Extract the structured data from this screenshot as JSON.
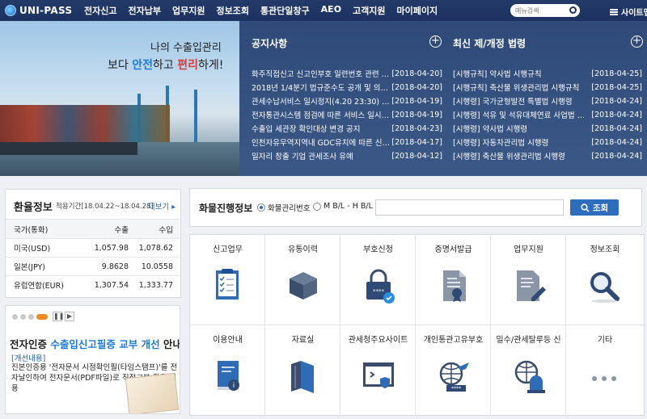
{
  "header": {
    "logo": "UNI-PASS",
    "nav": [
      "전자신고",
      "전자납부",
      "업무지원",
      "정보조회",
      "통관단일창구",
      "AEO",
      "고객지원",
      "마이페이지"
    ],
    "search_placeholder": "메뉴검색",
    "sitemap": "사이트맵"
  },
  "banner": {
    "line1": "나의 수출입관리",
    "line2_pre": "보다 ",
    "line2_a": "안전",
    "line2_mid": "하고 ",
    "line2_b": "편리",
    "line2_post": "하게!"
  },
  "notice": {
    "title": "공지사항",
    "items": [
      {
        "title": "화주직접신고 신고인부호 일련번호 관련 안...",
        "date": "[2018-04-20]"
      },
      {
        "title": "2018년 1/4분기 법규준수도 공개 및 의견제...",
        "date": "[2018-04-20]"
      },
      {
        "title": "관세수납서비스 일시정지(4.20 23:30) 안내",
        "date": "[2018-04-19]"
      },
      {
        "title": "전자통관시스템 점검에 따른 서비스 일시중...",
        "date": "[2018-04-19]"
      },
      {
        "title": "수출입 세관장 확인대상 변경 공지",
        "date": "[2018-04-23]"
      },
      {
        "title": "인천자유무역지역내 GDC유치에 따른 신규 ...",
        "date": "[2018-04-17]"
      },
      {
        "title": "일자리 창출 기업 관세조사 유예",
        "date": "[2018-04-12]"
      }
    ]
  },
  "laws": {
    "title": "최신 제/개정 법령",
    "items": [
      {
        "title": "[시행규칙] 약사법 시행규칙",
        "date": "[2018-04-25]"
      },
      {
        "title": "[시행규칙] 축산물 위생관리법 시행규칙",
        "date": "[2018-04-25]"
      },
      {
        "title": "[시행령] 국가균형발전 특별법 시행령",
        "date": "[2018-04-24]"
      },
      {
        "title": "[시행령] 석유 및 석유대체연료 사업법 시...",
        "date": "[2018-04-24]"
      },
      {
        "title": "[시행령] 약사법 시행령",
        "date": "[2018-04-24]"
      },
      {
        "title": "[시행령] 자동차관리법 시행령",
        "date": "[2018-04-24]"
      },
      {
        "title": "[시행령] 축산물 위생관리법 시행령",
        "date": "[2018-04-24]"
      }
    ]
  },
  "exchange": {
    "title": "환율정보",
    "period": "적용기간[18.04.22~18.04.28]",
    "more": "더보기 ▸",
    "headers": [
      "국가(통화)",
      "수출",
      "수입"
    ],
    "rows": [
      [
        "미국(USD)",
        "1,057.98",
        "1,078.62"
      ],
      [
        "일본(JPY)",
        "9.8628",
        "10.0558"
      ],
      [
        "유럽연합(EUR)",
        "1,307.54",
        "1,333.77"
      ]
    ]
  },
  "ad": {
    "title_pre": "전자인증 ",
    "title_hl": "수출입신고필증 교부 개선",
    "title_post": " 안내",
    "sub": "[개선내용]",
    "body": "진본인증용 '전자문서 시점확인필(타임스탬프)'를 전자날인하여 전자문서(PDF파일)로 직접교부·활용 허용"
  },
  "cargo": {
    "title": "화물진행정보",
    "opt1": "화물관리번호",
    "opt2": "M B/L - H B/L",
    "button": "조회"
  },
  "services": {
    "row1": [
      "신고업무",
      "유통이력",
      "부호신청",
      "증명서발급",
      "업무지원",
      "정보조회"
    ],
    "row2": [
      "이용안내",
      "자료실",
      "관세청주요사이트",
      "개인통관고유부호",
      "밀수/관세탈루등 신",
      "기타"
    ]
  },
  "colors": {
    "nav_bg": "#1c3160",
    "news_bg": "#34507f",
    "accent_blue": "#1c7ad9",
    "btn_blue": "#2e6dbb",
    "orange": "#f08a24"
  }
}
